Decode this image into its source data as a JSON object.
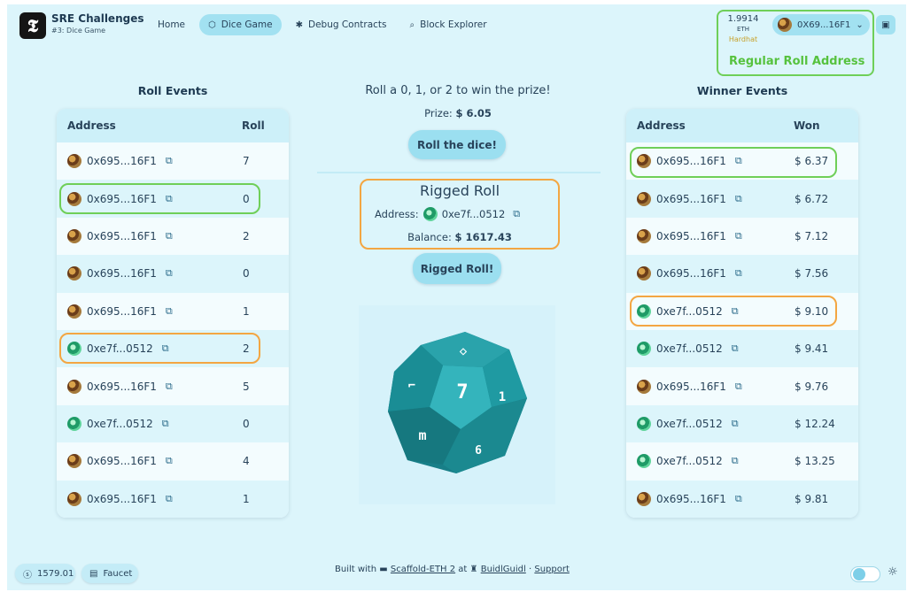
{
  "header": {
    "logo_glyph": "𝕿",
    "app_title": "SRE Challenges",
    "app_subtitle": "#3: Dice Game",
    "nav": [
      {
        "label": "Home",
        "icon": "home",
        "active": false
      },
      {
        "label": "Dice Game",
        "icon": "cube-icon",
        "active": true
      },
      {
        "label": "Debug Contracts",
        "icon": "bug-icon",
        "active": false
      },
      {
        "label": "Block Explorer",
        "icon": "search-icon",
        "active": false
      }
    ],
    "balance_value": "1.9914",
    "balance_unit": "ETH",
    "network": "Hardhat",
    "account": "0X69...16F1",
    "annotation": "Regular Roll Address"
  },
  "roll_events": {
    "title": "Roll Events",
    "col_address": "Address",
    "col_roll": "Roll",
    "rows": [
      {
        "address": "0x695...16F1",
        "value": "7",
        "avatar": "brown"
      },
      {
        "address": "0x695...16F1",
        "value": "0",
        "avatar": "brown"
      },
      {
        "address": "0x695...16F1",
        "value": "2",
        "avatar": "brown"
      },
      {
        "address": "0x695...16F1",
        "value": "0",
        "avatar": "brown"
      },
      {
        "address": "0x695...16F1",
        "value": "1",
        "avatar": "brown"
      },
      {
        "address": "0xe7f...0512",
        "value": "2",
        "avatar": "green"
      },
      {
        "address": "0x695...16F1",
        "value": "5",
        "avatar": "brown"
      },
      {
        "address": "0xe7f...0512",
        "value": "0",
        "avatar": "green"
      },
      {
        "address": "0x695...16F1",
        "value": "4",
        "avatar": "brown"
      },
      {
        "address": "0x695...16F1",
        "value": "1",
        "avatar": "brown"
      }
    ]
  },
  "center": {
    "headline": "Roll a 0, 1, or 2 to win the prize!",
    "prize_label": "Prize:",
    "prize_value": "$ 6.05",
    "roll_button": "Roll the dice!",
    "rigged_title": "Rigged Roll",
    "rigged_address_label": "Address:",
    "rigged_address": "0xe7f...0512",
    "rigged_balance_label": "Balance:",
    "rigged_balance": "$ 1617.43",
    "rigged_button": "Rigged Roll!",
    "dice_face": "7"
  },
  "winner_events": {
    "title": "Winner Events",
    "col_address": "Address",
    "col_won": "Won",
    "rows": [
      {
        "address": "0x695...16F1",
        "value": "$ 6.37",
        "avatar": "brown"
      },
      {
        "address": "0x695...16F1",
        "value": "$ 6.72",
        "avatar": "brown"
      },
      {
        "address": "0x695...16F1",
        "value": "$ 7.12",
        "avatar": "brown"
      },
      {
        "address": "0x695...16F1",
        "value": "$ 7.56",
        "avatar": "brown"
      },
      {
        "address": "0xe7f...0512",
        "value": "$ 9.10",
        "avatar": "green"
      },
      {
        "address": "0xe7f...0512",
        "value": "$ 9.41",
        "avatar": "green"
      },
      {
        "address": "0x695...16F1",
        "value": "$ 9.76",
        "avatar": "brown"
      },
      {
        "address": "0xe7f...0512",
        "value": "$ 12.24",
        "avatar": "green"
      },
      {
        "address": "0xe7f...0512",
        "value": "$ 13.25",
        "avatar": "green"
      },
      {
        "address": "0x695...16F1",
        "value": "$ 9.81",
        "avatar": "brown"
      }
    ]
  },
  "footer": {
    "price": "1579.01",
    "faucet": "Faucet",
    "built_with": "Built with",
    "scaffold": "Scaffold-ETH 2",
    "at": "at",
    "buidlguidl": "BuidlGuidl",
    "dot": "·",
    "support": "Support"
  },
  "colors": {
    "background": "#dcf5fb",
    "accent": "#a2e1f1",
    "highlight_green": "#6fcf58",
    "highlight_orange": "#f3a642",
    "dice": "#17858d"
  }
}
